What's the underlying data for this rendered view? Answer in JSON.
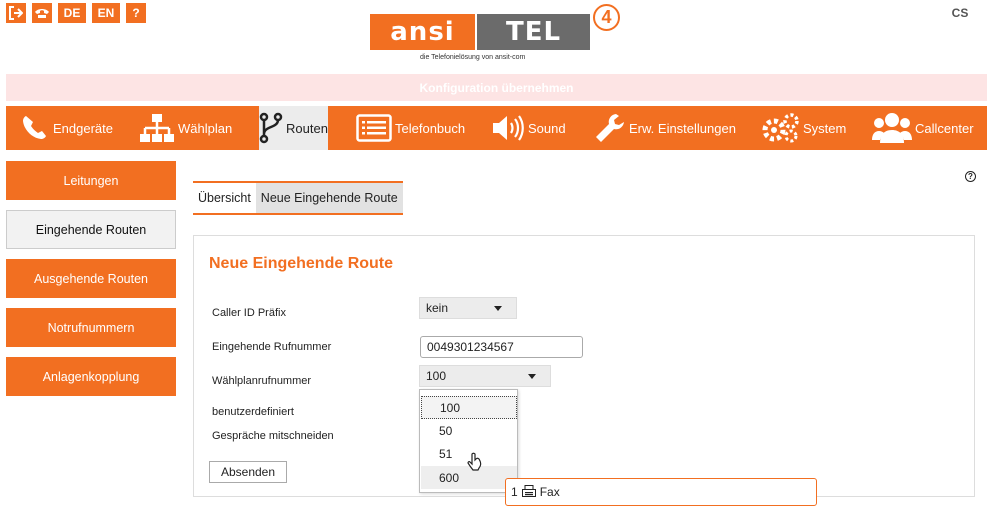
{
  "colors": {
    "accent": "#f26f21",
    "apply_bar": "#fde4e4",
    "active_nav": "#ececec"
  },
  "top_icons": {
    "logout_icon": "logout-icon",
    "phone_icon": "phone-icon",
    "lang_de": "DE",
    "lang_en": "EN",
    "help_icon": "?",
    "cs_badge": "CS"
  },
  "logo": {
    "left_text": "ansi",
    "right_text": "TEL",
    "version": "4",
    "tagline": "die Telefonielösung von ansit-com"
  },
  "apply_bar": {
    "label": "Konfiguration übernehmen"
  },
  "nav": {
    "items": [
      {
        "label": "Endgeräte",
        "icon": "phone-icon"
      },
      {
        "label": "Wählplan",
        "icon": "sitemap-icon"
      },
      {
        "label": "Routen",
        "icon": "route-icon",
        "active": true
      },
      {
        "label": "Telefonbuch",
        "icon": "list-icon"
      },
      {
        "label": "Sound",
        "icon": "speaker-icon"
      },
      {
        "label": "Erw. Einstellungen",
        "icon": "wrench-icon"
      },
      {
        "label": "System",
        "icon": "gears-icon"
      },
      {
        "label": "Callcenter",
        "icon": "users-icon"
      }
    ]
  },
  "sidebar": {
    "items": [
      {
        "label": "Leitungen"
      },
      {
        "label": "Eingehende Routen",
        "active": true
      },
      {
        "label": "Ausgehende Routen"
      },
      {
        "label": "Notrufnummern"
      },
      {
        "label": "Anlagenkopplung"
      }
    ]
  },
  "tabs": {
    "items": [
      {
        "label": "Übersicht"
      },
      {
        "label": "Neue Eingehende Route",
        "active": true
      }
    ]
  },
  "help": {
    "label": "?"
  },
  "form": {
    "title": "Neue Eingehende Route",
    "caller_id_label": "Caller ID Präfix",
    "caller_id_value": "kein",
    "incoming_number_label": "Eingehende Rufnummer",
    "incoming_number_value": "0049301234567",
    "dialplan_label": "Wählplanrufnummer",
    "dialplan_value": "100",
    "custom_label": "benutzerdefiniert",
    "record_label": "Gespräche mitschneiden",
    "submit_label": "Absenden"
  },
  "dropdown": {
    "options": [
      "100",
      "50",
      "51",
      "600"
    ],
    "selected": "100",
    "hovered": "600"
  },
  "tooltip": {
    "prefix": "1",
    "icon": "fax-icon",
    "label": "Fax"
  }
}
